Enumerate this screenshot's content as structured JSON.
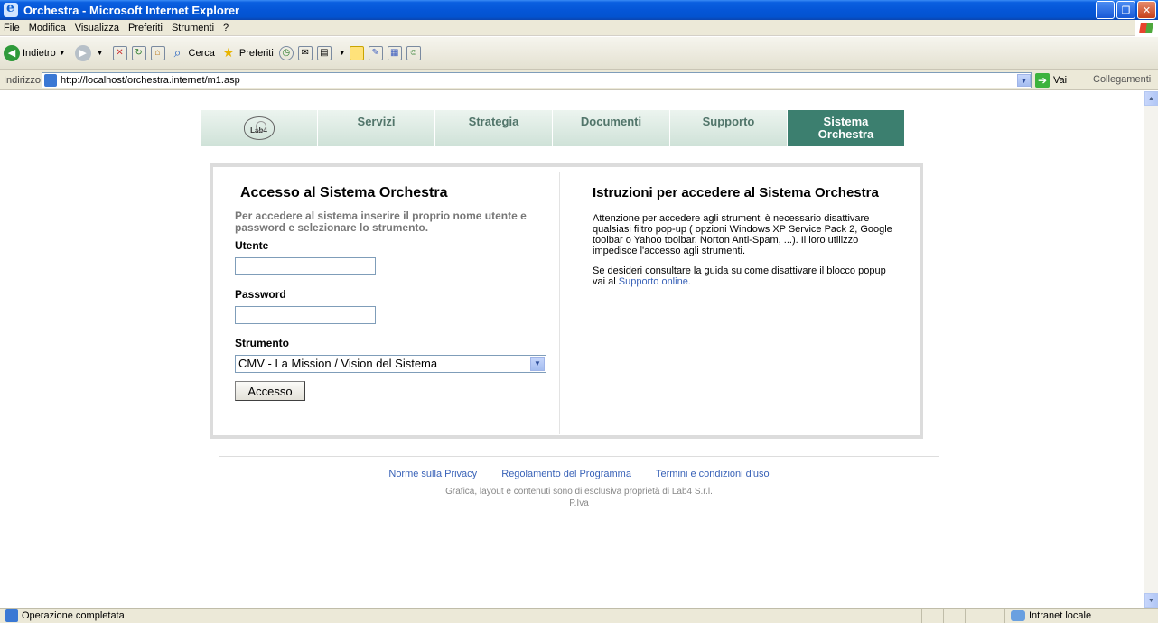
{
  "window": {
    "title": "Orchestra - Microsoft Internet Explorer"
  },
  "menu": {
    "items": [
      "File",
      "Modifica",
      "Visualizza",
      "Preferiti",
      "Strumenti",
      "?"
    ]
  },
  "toolbar": {
    "back_label": "Indietro",
    "search_label": "Cerca",
    "favorites_label": "Preferiti"
  },
  "address": {
    "label": "Indirizzo",
    "url": "http://localhost/orchestra.internet/m1.asp",
    "go_label": "Vai",
    "links_label": "Collegamenti"
  },
  "nav": {
    "logo_text": "Lab4",
    "tabs": [
      "Servizi",
      "Strategia",
      "Documenti",
      "Supporto"
    ],
    "active_line1": "Sistema",
    "active_line2": "Orchestra"
  },
  "login": {
    "title": "Accesso al Sistema Orchestra",
    "intro": "Per accedere al sistema inserire il proprio nome utente e password e selezionare lo strumento.",
    "user_label": "Utente",
    "user_value": "",
    "password_label": "Password",
    "password_value": "",
    "tool_label": "Strumento",
    "tool_selected": "CMV - La Mission / Vision del Sistema",
    "submit_label": "Accesso"
  },
  "instructions": {
    "title": "Istruzioni per accedere al Sistema Orchestra",
    "p1": "Attenzione per accedere agli strumenti è necessario disattivare qualsiasi filtro pop-up ( opzioni Windows XP Service Pack 2, Google toolbar o Yahoo toolbar, Norton Anti-Spam, ...). Il loro utilizzo impedisce l'accesso agli strumenti.",
    "p2_prefix": "Se desideri consultare la guida su come disattivare il blocco popup vai al",
    "p2_link": "Supporto online."
  },
  "footer": {
    "links": [
      "Norme sulla Privacy",
      "Regolamento del Programma",
      "Termini e condizioni d'uso"
    ],
    "line1": "Grafica, layout e contenuti sono di esclusiva proprietà di Lab4 S.r.l.",
    "line2": "P.Iva"
  },
  "status": {
    "text": "Operazione completata",
    "zone": "Intranet locale"
  }
}
